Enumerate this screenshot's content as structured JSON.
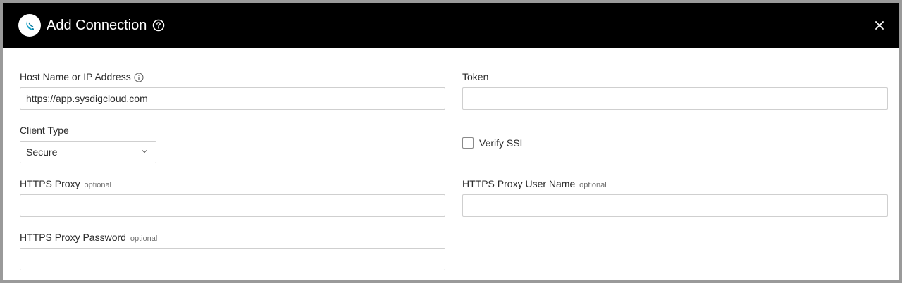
{
  "dialog": {
    "title": "Add Connection",
    "logo_icon": "sysdig-logo-icon",
    "help_icon": "question-circle-icon",
    "close_icon": "close-icon",
    "header_color": "#000000"
  },
  "fields": {
    "host": {
      "label": "Host Name or IP Address",
      "info_icon": "info-circle-icon",
      "value": "https://app.sysdigcloud.com"
    },
    "token": {
      "label": "Token",
      "value": ""
    },
    "client_type": {
      "label": "Client Type",
      "selected": "Secure"
    },
    "verify_ssl": {
      "label": "Verify SSL",
      "checked": false
    },
    "https_proxy": {
      "label": "HTTPS Proxy",
      "optional": "optional",
      "value": ""
    },
    "https_proxy_user": {
      "label": "HTTPS Proxy User Name",
      "optional": "optional",
      "value": ""
    },
    "https_proxy_password": {
      "label": "HTTPS Proxy Password",
      "optional": "optional",
      "value": ""
    }
  }
}
